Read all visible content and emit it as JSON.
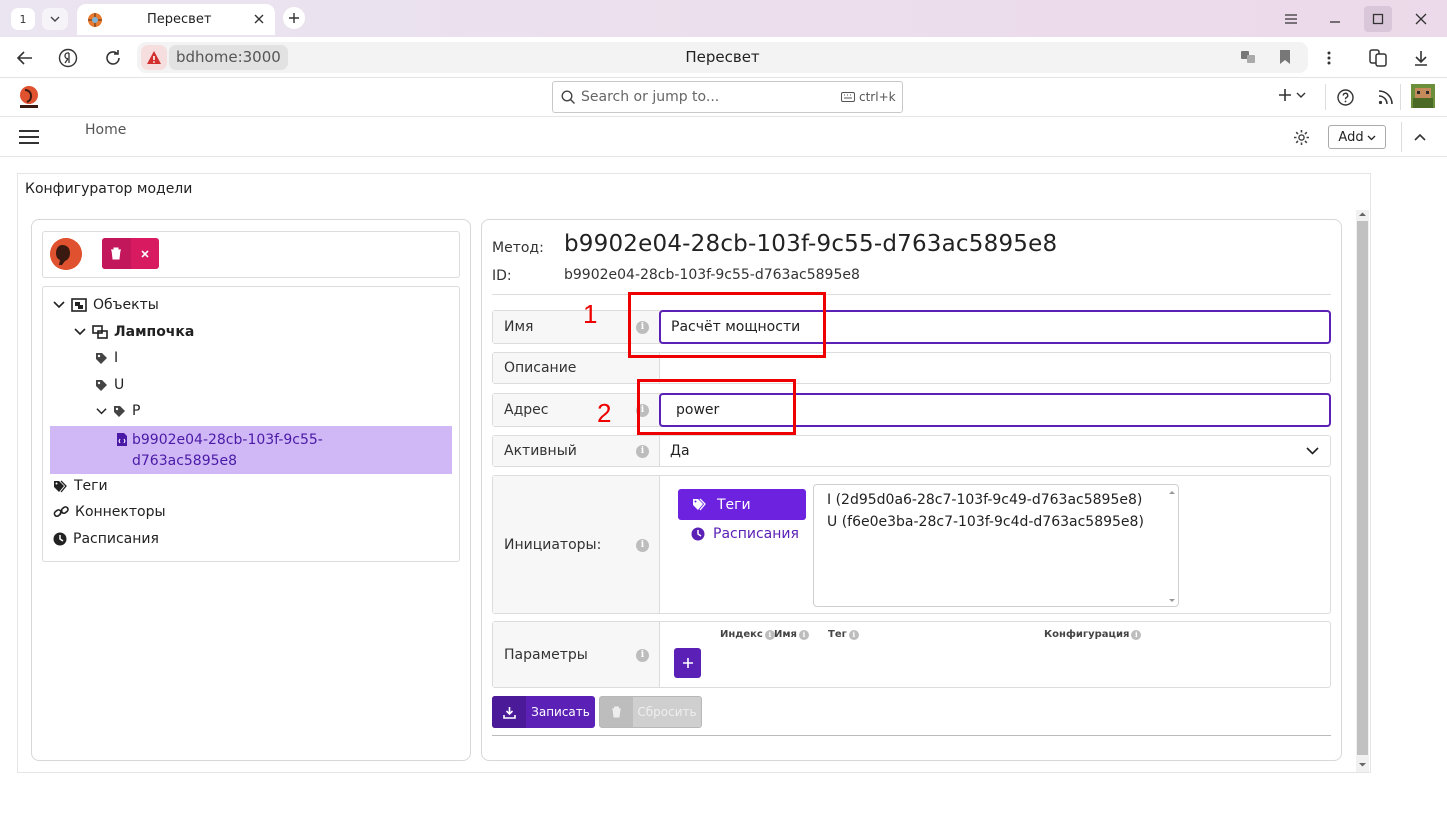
{
  "browser": {
    "tab_count": "1",
    "tab_title": "Пересвет",
    "host": "bdhome:3000",
    "page_title": "Пересвет"
  },
  "header": {
    "search_placeholder": "Search or jump to...",
    "search_shortcut": "ctrl+k",
    "home_label": "Home",
    "add_label": "Add"
  },
  "page": {
    "card_title": "Конфигуратор модели"
  },
  "tree": {
    "objects": "Объекты",
    "lamp": "Лампочка",
    "tag_i": "I",
    "tag_u": "U",
    "tag_p": "P",
    "selected_line1": "b9902e04-28cb-103f-9c55-",
    "selected_line2": "d763ac5895e8",
    "tags": "Теги",
    "connectors": "Коннекторы",
    "schedules": "Расписания"
  },
  "form": {
    "method_label": "Метод:",
    "method_value": "b9902e04-28cb-103f-9c55-d763ac5895e8",
    "id_label": "ID:",
    "id_value": "b9902e04-28cb-103f-9c55-d763ac5895e8",
    "name_label": "Имя",
    "name_value": "Расчёт мощности",
    "description_label": "Описание",
    "description_value": "",
    "address_label": "Адрес",
    "address_value": "power",
    "active_label": "Активный",
    "active_value": "Да",
    "initiators_label": "Инициаторы:",
    "initiators_tags_button": "Теги",
    "initiators_schedules_link": "Расписания",
    "initiators_list": [
      "I (2d95d0a6-28c7-103f-9c49-d763ac5895e8)",
      "U (f6e0e3ba-28c7-103f-9c4d-d763ac5895e8)"
    ],
    "params_label": "Параметры",
    "params_headers": {
      "index": "Индекс",
      "name": "Имя",
      "tag": "Тег",
      "config": "Конфигурация"
    },
    "save_label": "Записать",
    "reset_label": "Сбросить"
  },
  "annotations": {
    "one": "1",
    "two": "2"
  },
  "colors": {
    "accent": "#5b21b6",
    "danger": "#d81b60",
    "selection": "#d0b8f7",
    "annotation": "#ee0000"
  }
}
